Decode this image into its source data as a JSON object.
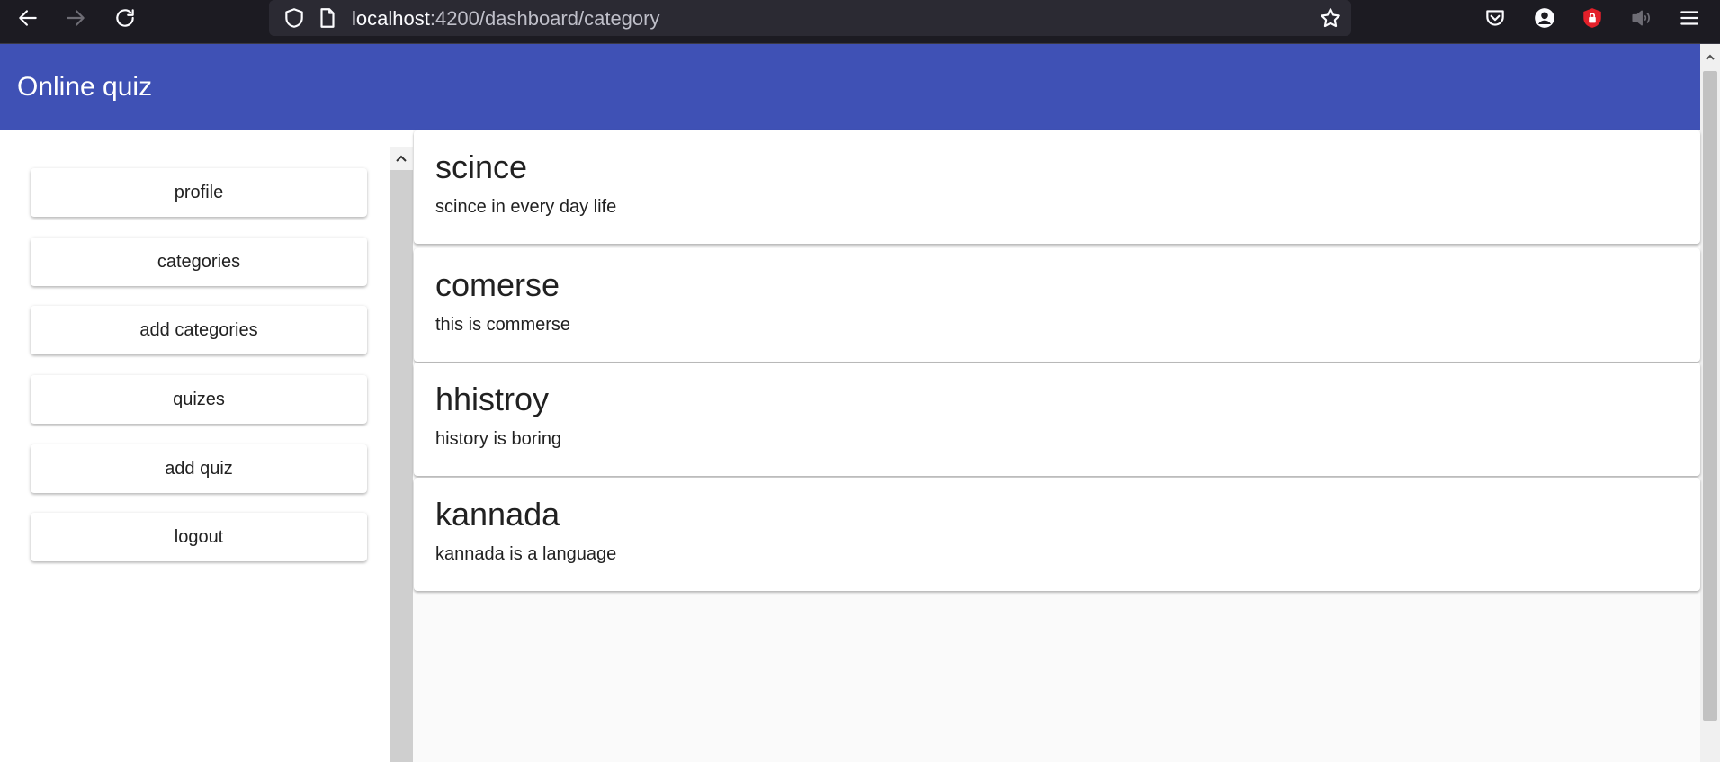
{
  "browser": {
    "url_host": "localhost",
    "url_path": ":4200/dashboard/category"
  },
  "app": {
    "title": "Online quiz",
    "header_color": "#3f51b5"
  },
  "sidebar": {
    "items": [
      {
        "label": "profile"
      },
      {
        "label": "categories"
      },
      {
        "label": "add categories"
      },
      {
        "label": "quizes"
      },
      {
        "label": "add quiz"
      },
      {
        "label": "logout"
      }
    ]
  },
  "categories": [
    {
      "title": "scince",
      "description": "scince in every day life"
    },
    {
      "title": "comerse",
      "description": "this is commerse"
    },
    {
      "title": "hhistroy",
      "description": "history is boring"
    },
    {
      "title": "kannada",
      "description": "kannada is a language"
    }
  ],
  "icons": {
    "back": "arrow-left-icon",
    "forward": "arrow-right-icon",
    "reload": "reload-icon",
    "tracking": "shield-icon",
    "page": "page-icon",
    "bookmark": "star-icon",
    "pocket": "pocket-icon",
    "account": "account-icon",
    "extension": "lock-shield-icon",
    "audio": "speaker-icon",
    "menu": "hamburger-menu-icon"
  }
}
